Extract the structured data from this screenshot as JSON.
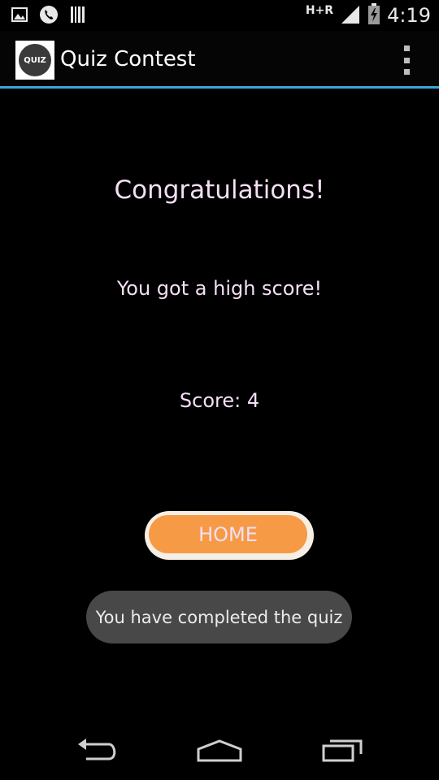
{
  "status_bar": {
    "time": "4:19",
    "network": "H+R",
    "icons": [
      "image-icon",
      "phone-icon",
      "barcode-icon",
      "signal-icon",
      "battery-icon"
    ]
  },
  "action_bar": {
    "title": "Quiz Contest",
    "app_icon_text": "QUIZ",
    "accent_color": "#3aa7d8"
  },
  "result": {
    "headline": "Congratulations!",
    "message": "You got a high score!",
    "score_text": "Score: 4"
  },
  "home_button": {
    "label": "HOME",
    "color": "#f69a46"
  },
  "toast": {
    "message": "You have completed the quiz"
  },
  "nav_bar": {
    "icons": [
      "back-icon",
      "home-icon",
      "recent-apps-icon"
    ]
  }
}
